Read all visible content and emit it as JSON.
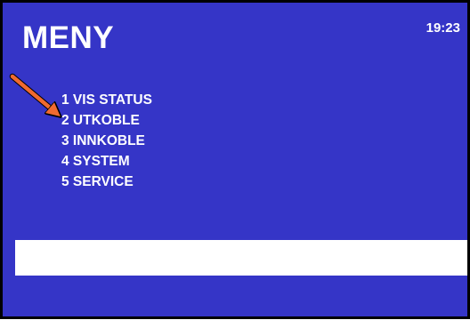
{
  "header": {
    "title": "MENY",
    "time": "19:23"
  },
  "menu": {
    "items": [
      {
        "label": "1 VIS STATUS"
      },
      {
        "label": "2 UTKOBLE"
      },
      {
        "label": "3 INNKOBLE"
      },
      {
        "label": "4 SYSTEM"
      },
      {
        "label": "5 SERVICE"
      }
    ],
    "pointed_item_index": 1
  },
  "input_bar": {
    "value": ""
  },
  "colors": {
    "background": "#3535c7",
    "text": "#ffffff",
    "border": "#000000",
    "arrow": "#f06a30",
    "input_bar": "#ffffff"
  },
  "icons": {
    "pointer": "arrow-pointer-icon"
  }
}
